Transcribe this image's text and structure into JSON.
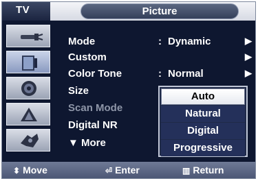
{
  "title_bar": {
    "tab_tv": "TV",
    "tab_picture": "Picture"
  },
  "sidebar": {
    "icons": [
      "antenna-icon",
      "picture-icon",
      "speaker-icon",
      "channel-icon",
      "setup-icon"
    ]
  },
  "menu": {
    "rows": [
      {
        "label": "Mode",
        "value": "Dynamic",
        "has_colon": true,
        "arrow": "▶"
      },
      {
        "label": "Custom",
        "value": "",
        "has_colon": false,
        "arrow": "▶"
      },
      {
        "label": "Color Tone",
        "value": "Normal",
        "has_colon": true,
        "arrow": "▶"
      },
      {
        "label": "Size",
        "value": "",
        "has_colon": false,
        "arrow": ""
      },
      {
        "label": "Scan Mode",
        "value": "",
        "has_colon": true,
        "arrow": "",
        "disabled": true
      },
      {
        "label": "Digital NR",
        "value": "",
        "has_colon": true,
        "arrow": ""
      },
      {
        "label": "▼ More",
        "value": "",
        "has_colon": false,
        "arrow": ""
      }
    ],
    "colon": ":"
  },
  "dropdown": {
    "options": [
      "Auto",
      "Natural",
      "Digital",
      "Progressive"
    ],
    "selected": "Auto"
  },
  "bottom_bar": {
    "move": {
      "glyph": "⬍",
      "label": "Move"
    },
    "enter": {
      "glyph": "⏎",
      "label": "Enter"
    },
    "return": {
      "glyph": "▥",
      "label": "Return"
    }
  },
  "colors": {
    "background": "#0e1730",
    "title_bar": "#d6dae3",
    "bottom_bar": "#5b6681",
    "selection": "#ffffff",
    "text": "#ffffff",
    "disabled_text": "#8e96a8"
  }
}
